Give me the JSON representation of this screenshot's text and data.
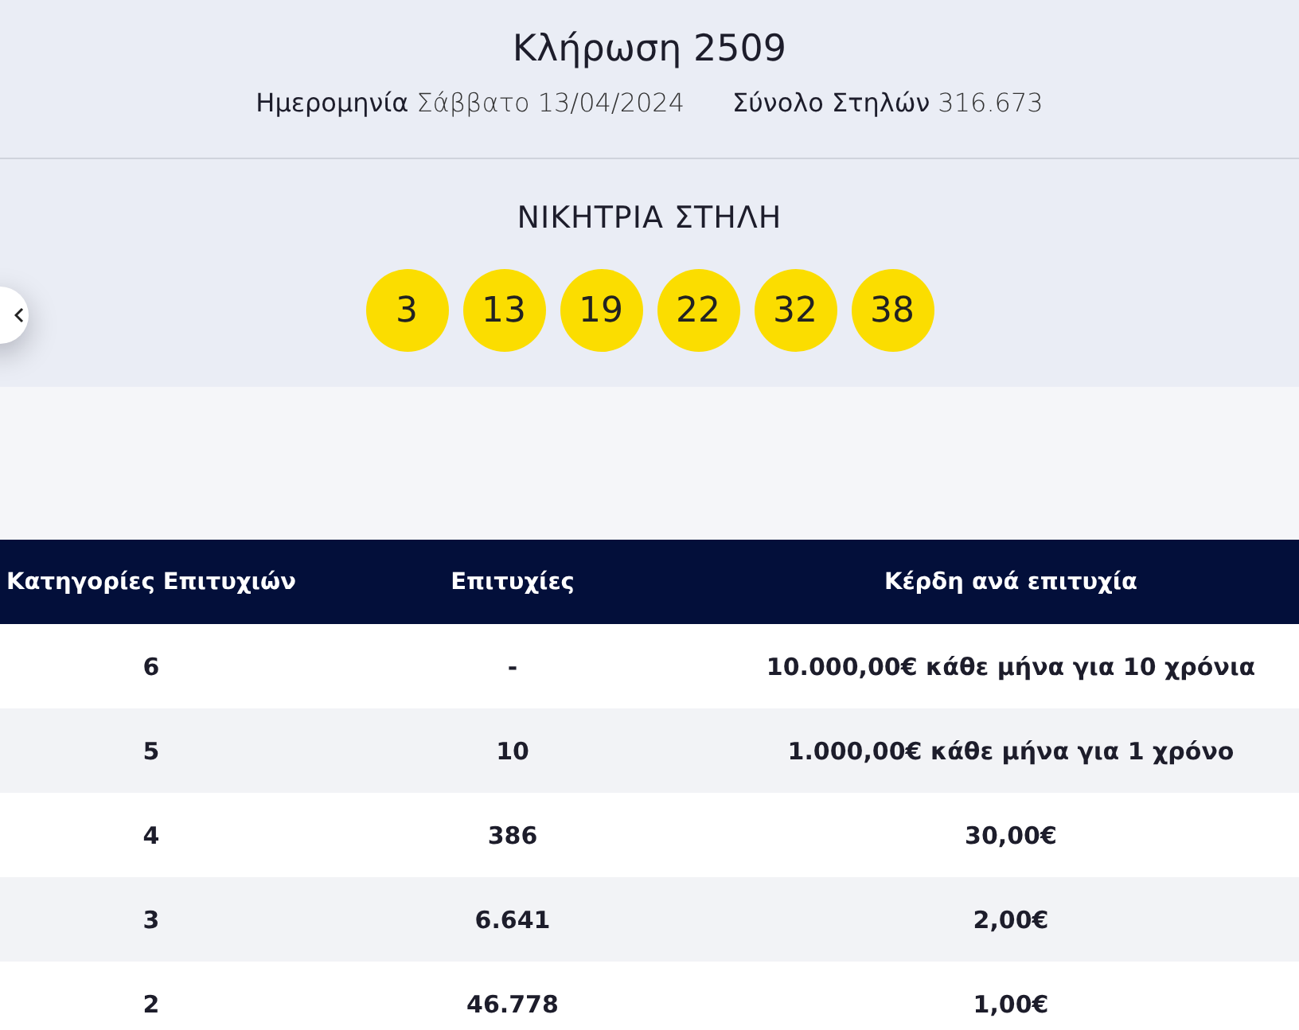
{
  "draw": {
    "title": "Κλήρωση 2509",
    "meta": [
      {
        "label": "Ημερομηνία",
        "value": "Σάββατο 13/04/2024"
      },
      {
        "label": "Σύνολο Στηλών",
        "value": "316.673"
      }
    ]
  },
  "winning_column": {
    "heading": "ΝΙΚΗΤΡΙΑ ΣΤΗΛΗ",
    "numbers": [
      "3",
      "13",
      "19",
      "22",
      "32",
      "38"
    ]
  },
  "table": {
    "columns": [
      "Κατηγορίες Επιτυχιών",
      "Επιτυχίες",
      "Κέρδη ανά επιτυχία"
    ],
    "rows": [
      [
        "6",
        "-",
        "10.000,00€ κάθε μήνα για 10 χρόνια"
      ],
      [
        "5",
        "10",
        "1.000,00€ κάθε μήνα για 1 χρόνο"
      ],
      [
        "4",
        "386",
        "30,00€"
      ],
      [
        "3",
        "6.641",
        "2,00€"
      ],
      [
        "2",
        "46.778",
        "1,00€"
      ]
    ]
  }
}
